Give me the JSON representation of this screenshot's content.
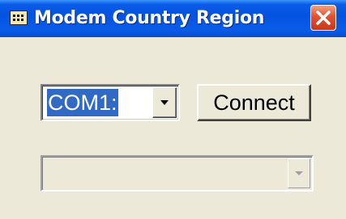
{
  "window": {
    "title": "Modem Country Region"
  },
  "port_select": {
    "selected": "COM1:"
  },
  "connect_button": {
    "label": "Connect"
  },
  "region_select": {
    "selected": ""
  },
  "colors": {
    "titlebar": "#0453e0",
    "close": "#e2512f",
    "selection": "#316ac5",
    "face": "#ece9d8"
  },
  "icons": {
    "app": "modem-grid-icon",
    "close": "close-x-icon",
    "dropdown": "chevron-down-icon"
  }
}
